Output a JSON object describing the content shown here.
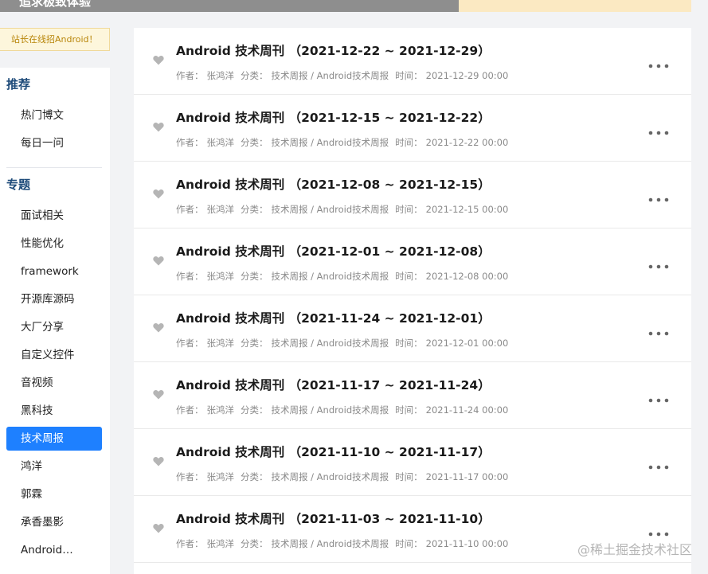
{
  "banner": {
    "text": "追求极致体验"
  },
  "notice": {
    "text": "站长在线招Android！"
  },
  "sidebar": {
    "recommend_title": "推荐",
    "recommend_items": [
      "热门博文",
      "每日一问"
    ],
    "topics_title": "专题",
    "topic_items": [
      "面试相关",
      "性能优化",
      "framework",
      "开源库源码",
      "大厂分享",
      "自定义控件",
      "音视频",
      "黑科技",
      "技术周报",
      "鸿洋",
      "郭霖",
      "承香墨影",
      "Android…"
    ],
    "active_item": "技术周报"
  },
  "meta_labels": {
    "author": "作者：",
    "category": "分类：",
    "time": "时间："
  },
  "articles": [
    {
      "title": "Android 技术周刊 （2021-12-22 ~ 2021-12-29）",
      "author": "张鸿洋",
      "category": "技术周报 / Android技术周报",
      "time": "2021-12-29 00:00"
    },
    {
      "title": "Android 技术周刊 （2021-12-15 ~ 2021-12-22）",
      "author": "张鸿洋",
      "category": "技术周报 / Android技术周报",
      "time": "2021-12-22 00:00"
    },
    {
      "title": "Android 技术周刊 （2021-12-08 ~ 2021-12-15）",
      "author": "张鸿洋",
      "category": "技术周报 / Android技术周报",
      "time": "2021-12-15 00:00"
    },
    {
      "title": "Android 技术周刊 （2021-12-01 ~ 2021-12-08）",
      "author": "张鸿洋",
      "category": "技术周报 / Android技术周报",
      "time": "2021-12-08 00:00"
    },
    {
      "title": "Android 技术周刊 （2021-11-24 ~ 2021-12-01）",
      "author": "张鸿洋",
      "category": "技术周报 / Android技术周报",
      "time": "2021-12-01 00:00"
    },
    {
      "title": "Android 技术周刊 （2021-11-17 ~ 2021-11-24）",
      "author": "张鸿洋",
      "category": "技术周报 / Android技术周报",
      "time": "2021-11-24 00:00"
    },
    {
      "title": "Android 技术周刊 （2021-11-10 ~ 2021-11-17）",
      "author": "张鸿洋",
      "category": "技术周报 / Android技术周报",
      "time": "2021-11-17 00:00"
    },
    {
      "title": "Android 技术周刊 （2021-11-03 ~ 2021-11-10）",
      "author": "张鸿洋",
      "category": "技术周报 / Android技术周报",
      "time": "2021-11-10 00:00"
    }
  ],
  "icons": {
    "like": "heart-icon",
    "more": "more-icon"
  },
  "colors": {
    "accent": "#1e80ff",
    "section_title": "#1e4b7a"
  },
  "watermark": "@稀土掘金技术社区"
}
